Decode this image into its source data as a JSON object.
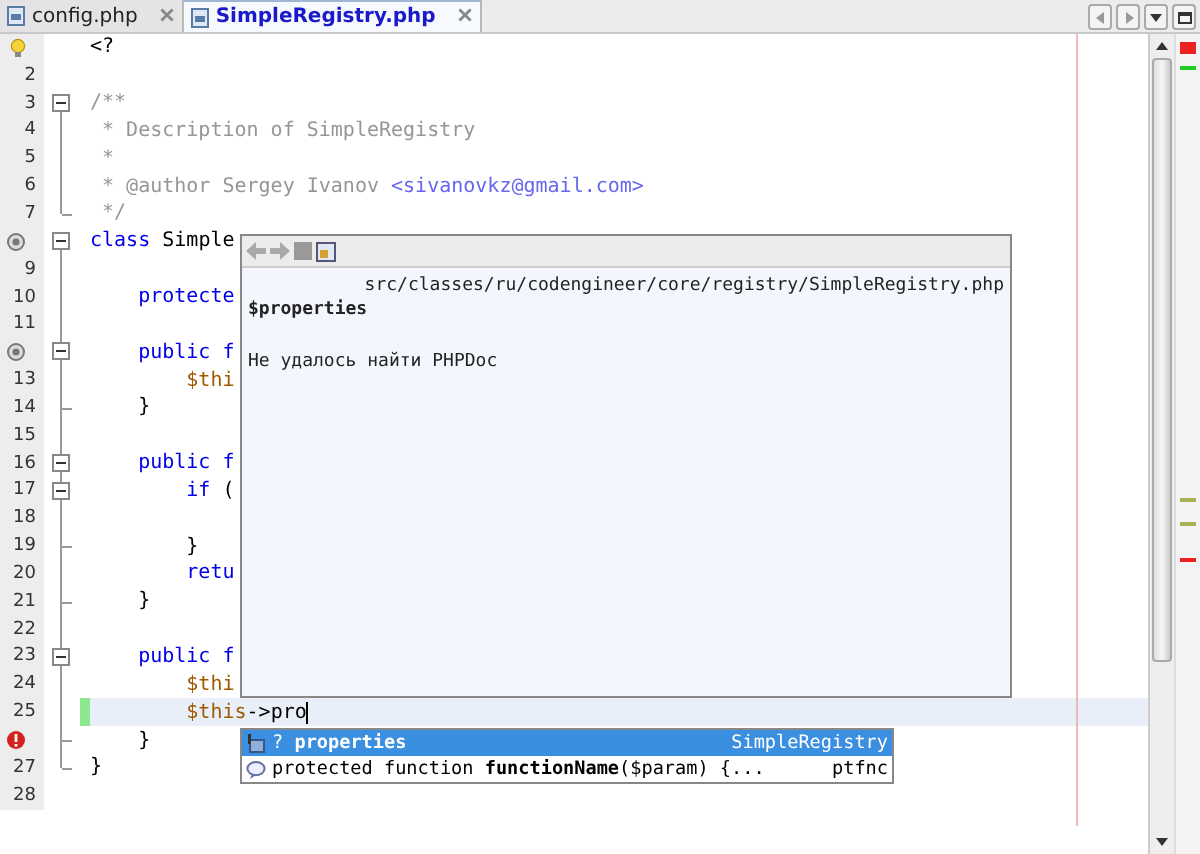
{
  "tabs": [
    {
      "label": "config.php",
      "selected": false
    },
    {
      "label": "SimpleRegistry.php",
      "selected": true
    }
  ],
  "lines": [
    {
      "kind": "hint",
      "fold_start": false,
      "fold_end": false,
      "changed": false,
      "current": false,
      "tokens": [
        {
          "text": "<?",
          "kind": "plain"
        }
      ]
    },
    {
      "number": "2",
      "kind": "code",
      "fold_start": false,
      "fold_end": false,
      "changed": false,
      "current": false
    },
    {
      "number": "3",
      "kind": "code",
      "fold_start": true,
      "fold_end": false,
      "changed": false,
      "current": false,
      "tokens": [
        {
          "text": "/**",
          "kind": "comment"
        }
      ]
    },
    {
      "number": "4",
      "kind": "code",
      "fold_start": false,
      "fold_end": false,
      "changed": false,
      "current": false,
      "tokens": [
        {
          "text": " * Description of SimpleRegistry",
          "kind": "comment"
        }
      ]
    },
    {
      "number": "5",
      "kind": "code",
      "fold_start": false,
      "fold_end": false,
      "changed": false,
      "current": false,
      "tokens": [
        {
          "text": " *",
          "kind": "comment"
        }
      ]
    },
    {
      "number": "6",
      "kind": "code",
      "fold_start": false,
      "fold_end": false,
      "changed": false,
      "current": false,
      "tokens": [
        {
          "text": " * @author Sergey Ivanov",
          "kind": "comment"
        },
        {
          "text": " <sivanovkz@gmail.com>",
          "kind": "link"
        }
      ]
    },
    {
      "number": "7",
      "kind": "code",
      "fold_start": false,
      "fold_end": true,
      "changed": false,
      "current": false,
      "tokens": [
        {
          "text": " */",
          "kind": "comment"
        }
      ]
    },
    {
      "kind": "override",
      "fold_start": true,
      "fold_end": false,
      "changed": false,
      "current": false,
      "tokens": [
        {
          "text": "class",
          "kind": "keyword"
        },
        {
          "text": " Simple",
          "kind": "plain"
        }
      ]
    },
    {
      "number": "9",
      "kind": "code",
      "fold_start": false,
      "fold_end": false,
      "changed": false,
      "current": false
    },
    {
      "number": "10",
      "kind": "code",
      "fold_start": false,
      "fold_end": false,
      "changed": false,
      "current": false,
      "tokens": [
        {
          "text": "    protecte",
          "kind": "keyword"
        }
      ]
    },
    {
      "number": "11",
      "kind": "code",
      "fold_start": false,
      "fold_end": false,
      "changed": false,
      "current": false
    },
    {
      "kind": "override",
      "fold_start": true,
      "fold_end": false,
      "changed": false,
      "current": false,
      "tokens": [
        {
          "text": "    public f",
          "kind": "keyword"
        }
      ]
    },
    {
      "number": "13",
      "kind": "code",
      "fold_start": false,
      "fold_end": false,
      "changed": false,
      "current": false,
      "tokens": [
        {
          "text": "        $thi",
          "kind": "variable"
        }
      ]
    },
    {
      "number": "14",
      "kind": "code",
      "fold_start": false,
      "fold_end": true,
      "changed": false,
      "current": false,
      "tokens": [
        {
          "text": "    }",
          "kind": "plain"
        }
      ]
    },
    {
      "number": "15",
      "kind": "code",
      "fold_start": false,
      "fold_end": false,
      "changed": false,
      "current": false
    },
    {
      "number": "16",
      "kind": "code",
      "fold_start": true,
      "fold_end": false,
      "changed": false,
      "current": false,
      "tokens": [
        {
          "text": "    public f",
          "kind": "keyword"
        }
      ]
    },
    {
      "number": "17",
      "kind": "code",
      "fold_start": true,
      "fold_end": false,
      "changed": false,
      "current": false,
      "tokens": [
        {
          "text": "        if",
          "kind": "keyword"
        },
        {
          "text": " (",
          "kind": "plain"
        }
      ]
    },
    {
      "number": "18",
      "kind": "code",
      "fold_start": false,
      "fold_end": false,
      "changed": false,
      "current": false
    },
    {
      "number": "19",
      "kind": "code",
      "fold_start": false,
      "fold_end": true,
      "changed": false,
      "current": false,
      "tokens": [
        {
          "text": "        }",
          "kind": "plain"
        }
      ]
    },
    {
      "number": "20",
      "kind": "code",
      "fold_start": false,
      "fold_end": false,
      "changed": false,
      "current": false,
      "tokens": [
        {
          "text": "        retu",
          "kind": "keyword"
        }
      ]
    },
    {
      "number": "21",
      "kind": "code",
      "fold_start": false,
      "fold_end": true,
      "changed": false,
      "current": false,
      "tokens": [
        {
          "text": "    }",
          "kind": "plain"
        }
      ]
    },
    {
      "number": "22",
      "kind": "code",
      "fold_start": false,
      "fold_end": false,
      "changed": false,
      "current": false
    },
    {
      "number": "23",
      "kind": "code",
      "fold_start": true,
      "fold_end": false,
      "changed": false,
      "current": false,
      "tokens": [
        {
          "text": "    public f",
          "kind": "keyword"
        }
      ]
    },
    {
      "number": "24",
      "kind": "code",
      "fold_start": false,
      "fold_end": false,
      "changed": false,
      "current": false,
      "tokens": [
        {
          "text": "        $thi",
          "kind": "variable"
        }
      ]
    },
    {
      "number": "25",
      "kind": "code",
      "fold_start": false,
      "fold_end": false,
      "changed": true,
      "current": true,
      "tokens": [
        {
          "text": "        $this",
          "kind": "variable"
        },
        {
          "text": "->pro",
          "kind": "plain"
        }
      ]
    },
    {
      "kind": "error",
      "fold_start": false,
      "fold_end": true,
      "changed": false,
      "current": false,
      "tokens": [
        {
          "text": "    }",
          "kind": "plain"
        }
      ]
    },
    {
      "number": "27",
      "kind": "code",
      "fold_start": false,
      "fold_end": true,
      "changed": false,
      "current": false,
      "tokens": [
        {
          "text": "}",
          "kind": "plain"
        }
      ]
    },
    {
      "number": "28",
      "kind": "code",
      "fold_start": false,
      "fold_end": false,
      "changed": false,
      "current": false
    }
  ],
  "doc_popup": {
    "path": "src/classes/ru/codengineer/core/registry/SimpleRegistry.php",
    "title": "$properties",
    "message": "Не удалось найти PHPDoc"
  },
  "completion": [
    {
      "kind": "field",
      "prefix": "?",
      "name": "properties",
      "detail": "SimpleRegistry",
      "selected": true
    },
    {
      "kind": "template",
      "prefix": "protected function",
      "name": "functionName",
      "rest": "($param) {...",
      "detail": "ptfnc",
      "selected": false
    }
  ]
}
